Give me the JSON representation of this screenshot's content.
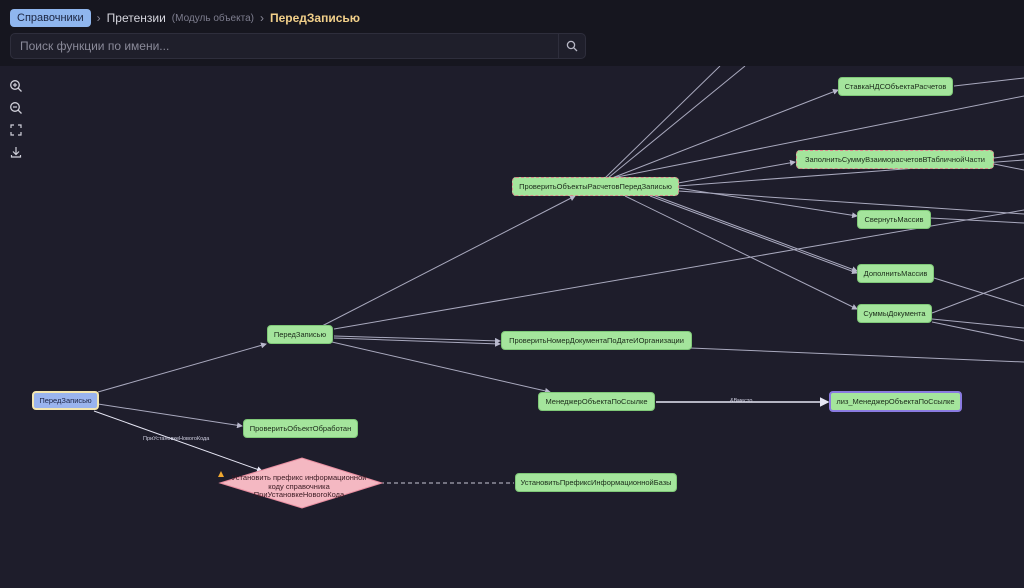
{
  "breadcrumb": {
    "root": "Справочники",
    "section": "Претензии",
    "section_note": "(Модуль объекта)",
    "current": "ПередЗаписью"
  },
  "search": {
    "placeholder": "Поиск функции по имени..."
  },
  "toolbar": {
    "items": [
      "zoom-in-icon",
      "zoom-out-icon",
      "fit-screen-icon",
      "download-icon"
    ]
  },
  "graph": {
    "nodes": {
      "root": "ПередЗаписью",
      "before_write": "ПередЗаписью",
      "check_processed": "ПроверитьОбъектОбработан",
      "prefix_decision_line1": "Установить префикс информационной",
      "prefix_decision_line2": "коду справочника",
      "prefix_decision_line3": "ПриУстановкеНовогоКода",
      "set_prefix": "УстановитьПрефиксИнформационнойБазы",
      "check_settlements": "ПроверитьОбъектыРасчетовПередЗаписью",
      "check_doc_number": "ПроверитьНомерДокументаПоДатеИОрганизации",
      "object_manager": "МенеджерОбъектаПоСсылке",
      "lib_object_manager": "лиз_МенеджерОбъектаПоСсылке",
      "vat_rate": "СтавкаНДСОбъектаРасчетов",
      "fill_sum": "ЗаполнитьСуммуВзаиморасчетовВТабличнойЧасти",
      "collapse_array": "СвернутьМассив",
      "append_array": "ДополнитьМассив",
      "doc_sums": "СуммыДокумента"
    },
    "edge_labels": {
      "on_new_code": "ПриУстановкеНовогоКода",
      "instead": "&Вместо"
    }
  }
}
